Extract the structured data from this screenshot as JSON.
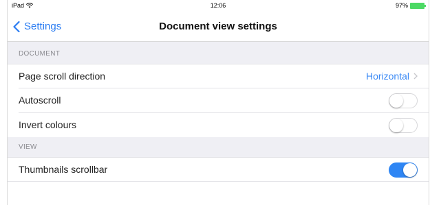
{
  "status": {
    "device": "iPad",
    "time": "12:06",
    "battery": "97%",
    "battery_color": "#4cd964"
  },
  "nav": {
    "back_label": "Settings",
    "title": "Document view settings"
  },
  "sections": {
    "document": "DOCUMENT",
    "view": "VIEW"
  },
  "rows": {
    "scroll_direction": {
      "label": "Page scroll direction",
      "value": "Horizontal"
    },
    "autoscroll": {
      "label": "Autoscroll",
      "on": false
    },
    "invert": {
      "label": "Invert colours",
      "on": false
    },
    "thumbnails": {
      "label": "Thumbnails scrollbar",
      "on": true
    }
  },
  "colors": {
    "accent": "#2f86f4",
    "group_bg": "#efeff4",
    "section_text": "#8a8a8f"
  }
}
